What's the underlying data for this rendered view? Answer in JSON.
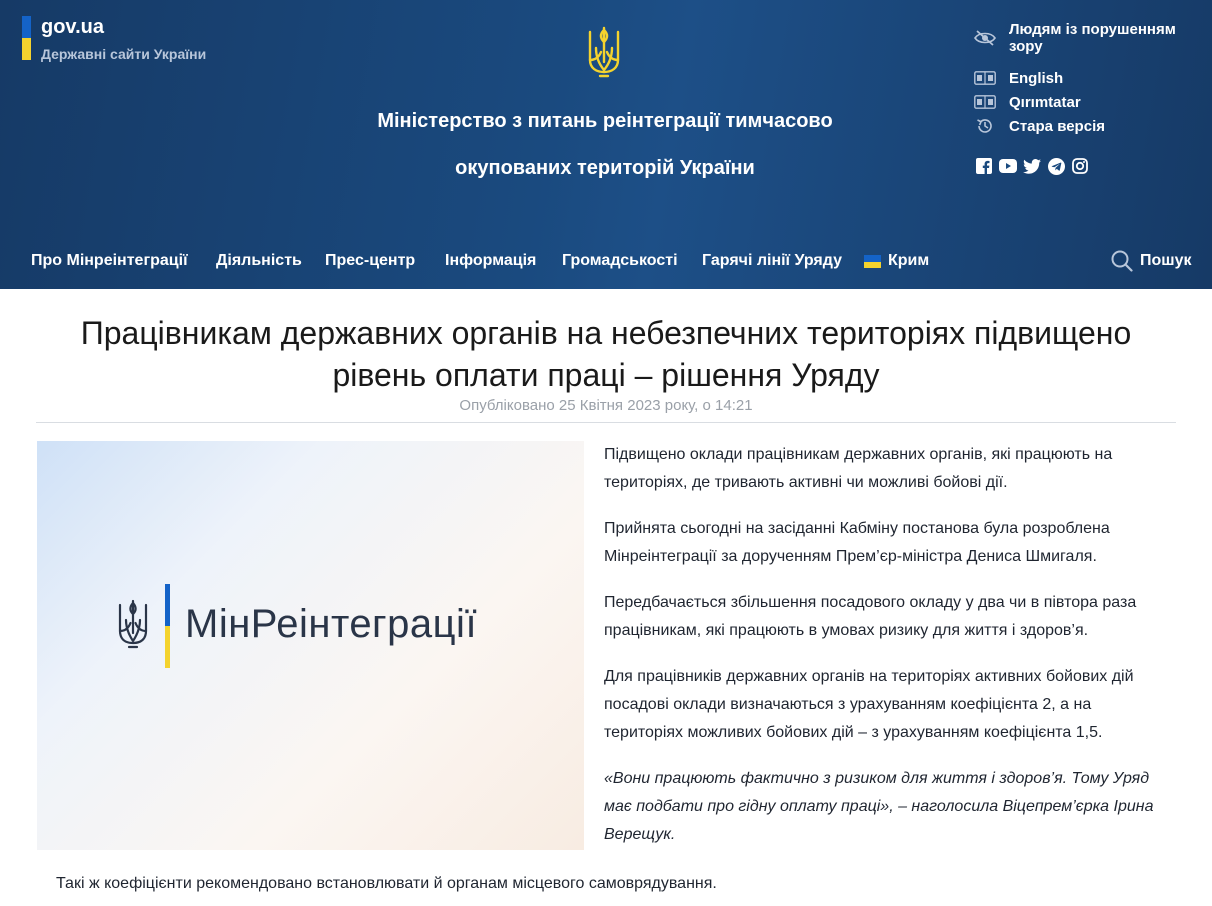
{
  "portal": {
    "name": "gov.ua",
    "subtitle": "Державні сайти України"
  },
  "header": {
    "ministry_title_line1": "Міністерство з питань реінтеграції тимчасово",
    "ministry_title_line2": "окупованих територій України"
  },
  "utility_links": {
    "accessibility": "Людям із порушенням зору",
    "english": "English",
    "crimean_tatar": "Qırımtatar",
    "old_version": "Стара версія"
  },
  "socials": [
    "facebook-icon",
    "youtube-icon",
    "twitter-icon",
    "telegram-icon",
    "instagram-icon"
  ],
  "nav": {
    "items": [
      "Про Мінреінтеграції",
      "Діяльність",
      "Прес-центр",
      "Інформація",
      "Громадськості",
      "Гарячі лінії Уряду",
      "Крим"
    ],
    "search_label": "Пошук"
  },
  "article": {
    "title_line1": "Працівникам державних органів на небезпечних територіях підвищено",
    "title_line2": "рівень оплати праці – рішення Уряду",
    "published": "Опубліковано 25 Квітня 2023 року, о 14:21",
    "image_logo_text": "МінРеінтеграції",
    "paragraphs": [
      "Підвищено оклади працівникам державних органів, які працюють на територіях, де тривають активні чи можливі бойові дії.",
      "Прийнята сьогодні на засіданні Кабміну постанова була розроблена Мінреінтеграції за дорученням Прем’єр-міністра Дениса Шмигаля.",
      "Передбачається збільшення посадового окладу у два чи в півтора раза працівникам, які працюють в умовах ризику для життя і здоров’я.",
      "Для працівників державних органів на територіях активних бойових дій посадові оклади визначаються з урахуванням коефіцієнта 2, а на територіях можливих бойових дій – з урахуванням коефіцієнта 1,5.",
      "«Вони працюють фактично з ризиком для життя і здоров’я. Тому Уряд має подбати про гідну оплату праці», – наголосила Віцепрем’єрка Ірина Верещук.",
      "Такі ж коефіцієнти рекомендовано встановлювати й органам місцевого самоврядування."
    ]
  },
  "colors": {
    "header_bg": "#1a4a7f",
    "flag_blue": "#1463c8",
    "flag_yellow": "#f4d32e"
  }
}
